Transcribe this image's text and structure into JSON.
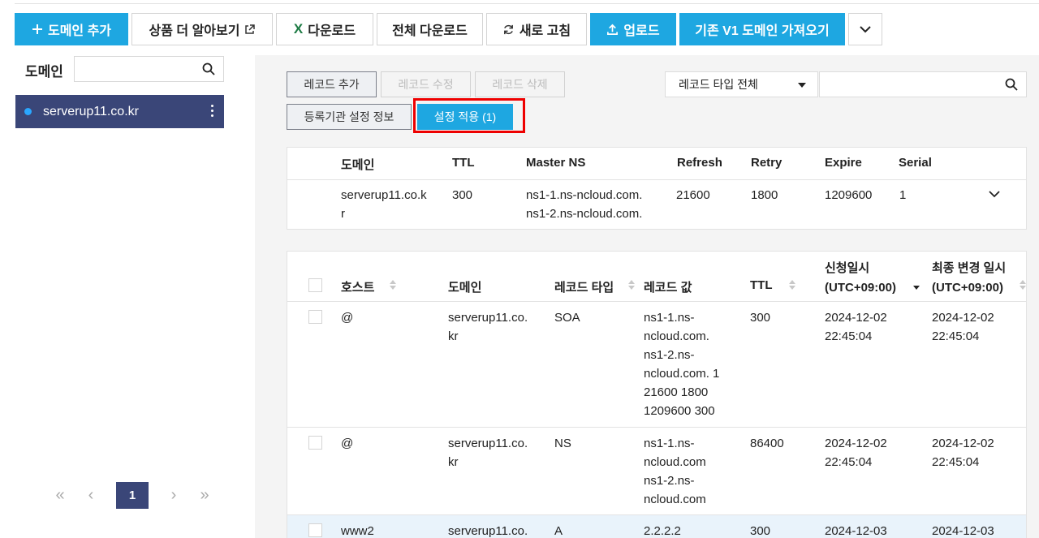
{
  "toolbar": {
    "add_domain": "도메인 추가",
    "learn_more": "상품 더 알아보기",
    "download": "다운로드",
    "download_all": "전체 다운로드",
    "refresh": "새로 고침",
    "upload": "업로드",
    "import_v1": "기존 V1 도메인 가져오기"
  },
  "sidebar": {
    "title": "도메인",
    "search_placeholder": "",
    "domains": [
      {
        "name": "serverup11.co.kr"
      }
    ],
    "pagination": {
      "current": "1"
    }
  },
  "record_actions": {
    "add": "레코드 추가",
    "edit": "레코드 수정",
    "delete": "레코드 삭제",
    "registrar_info": "등록기관 설정 정보",
    "apply": "설정 적용 (1)"
  },
  "filter": {
    "type_selected": "레코드 타입 전체",
    "search_placeholder": ""
  },
  "soa_table": {
    "headers": [
      "도메인",
      "TTL",
      "Master NS",
      "Refresh",
      "Retry",
      "Expire",
      "Serial"
    ],
    "row": {
      "domain_l1": "serverup11.co.k",
      "domain_l2": "r",
      "ttl": "300",
      "ns_l1": "ns1-1.ns-ncloud.com.",
      "ns_l2": "ns1-2.ns-ncloud.com.",
      "refresh": "21600",
      "retry": "1800",
      "expire": "1209600",
      "serial": "1"
    }
  },
  "records_table": {
    "headers": {
      "host": "호스트",
      "domain": "도메인",
      "type": "레코드 타입",
      "value": "레코드 값",
      "ttl": "TTL",
      "created_l1": "신청일시",
      "created_l2": "(UTC+09:00)",
      "modified_l1": "최종 변경 일시",
      "modified_l2": "(UTC+09:00)"
    },
    "rows": [
      {
        "host": "@",
        "domain_l1": "serverup11.co.",
        "domain_l2": "kr",
        "type": "SOA",
        "value": [
          "ns1-1.ns-",
          "ncloud.com.",
          "ns1-2.ns-",
          "ncloud.com. 1",
          "21600 1800",
          "1209600 300"
        ],
        "ttl": "300",
        "created_l1": "2024-12-02",
        "created_l2": "22:45:04",
        "modified_l1": "2024-12-02",
        "modified_l2": "22:45:04"
      },
      {
        "host": "@",
        "domain_l1": "serverup11.co.",
        "domain_l2": "kr",
        "type": "NS",
        "value": [
          "ns1-1.ns-",
          "ncloud.com",
          "ns1-2.ns-",
          "ncloud.com"
        ],
        "ttl": "86400",
        "created_l1": "2024-12-02",
        "created_l2": "22:45:04",
        "modified_l1": "2024-12-02",
        "modified_l2": "22:45:04"
      },
      {
        "host": "www2",
        "domain_l1": "serverup11.co.",
        "domain_l2": "",
        "type": "A",
        "value": [
          "2.2.2.2"
        ],
        "ttl": "300",
        "created_l1": "2024-12-03",
        "created_l2": "",
        "modified_l1": "2024-12-03",
        "modified_l2": ""
      }
    ]
  },
  "colors": {
    "primary": "#1ea7e1",
    "sidebar_active": "#3a4678",
    "highlight": "#ee0000",
    "excel_green": "#1e7b45"
  }
}
